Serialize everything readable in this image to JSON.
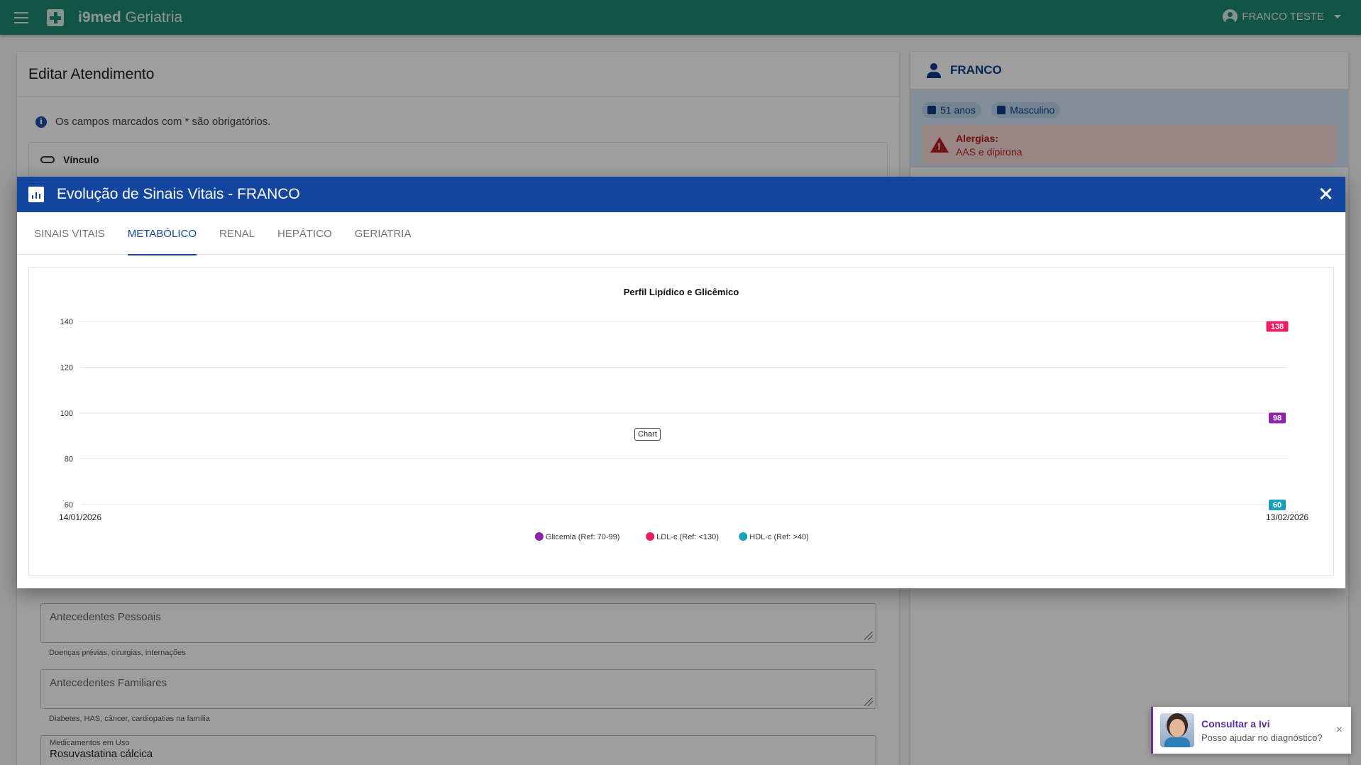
{
  "app": {
    "brand_bold": "i9med",
    "brand_rest": "Geriatria",
    "user_name": "FRANCO TESTE"
  },
  "form": {
    "title": "Editar Atendimento",
    "required_note": "Os campos marcados com * são obrigatórios.",
    "vinculo_label": "Vínculo",
    "antecedentes_pessoais": {
      "placeholder": "Antecedentes Pessoais",
      "helper": "Doenças prévias, cirurgias, internações"
    },
    "antecedentes_familiares": {
      "placeholder": "Antecedentes Familiares",
      "helper": "Diabetes, HAS, câncer, cardiopatias na família"
    },
    "medicamentos": {
      "label": "Medicamentos em Uso",
      "value": "Rosuvastatina cálcica"
    }
  },
  "patient": {
    "name": "FRANCO",
    "age": "51 anos",
    "sex": "Masculino",
    "allergy_title": "Alergias:",
    "allergy_text": "AAS e dipirona"
  },
  "dialog": {
    "title": "Evolução de Sinais Vitais - FRANCO",
    "tabs": [
      "SINAIS VITAIS",
      "METABÓLICO",
      "RENAL",
      "HEPÁTICO",
      "GERIATRIA"
    ],
    "active_tab": 1,
    "chart_tag": "Chart"
  },
  "chart_data": {
    "type": "line",
    "title": "Perfil Lipídico e Glicêmico",
    "x": [
      "14/01/2026",
      "13/02/2026"
    ],
    "ylim": [
      60,
      140
    ],
    "yticks": [
      60,
      80,
      100,
      120,
      140
    ],
    "grid": true,
    "legend_position": "bottom",
    "series": [
      {
        "name": "Glicemia (Ref: 70-99)",
        "color": "#8e24aa",
        "values": [
          null,
          98
        ]
      },
      {
        "name": "LDL-c (Ref: <130)",
        "color": "#e91e63",
        "values": [
          null,
          138
        ]
      },
      {
        "name": "HDL-c (Ref: >40)",
        "color": "#17a2b8",
        "values": [
          null,
          60
        ]
      }
    ]
  },
  "ivi": {
    "title": "Consultar a Ivi",
    "subtitle": "Posso ajudar no diagnóstico?",
    "close": "×"
  },
  "colors": {
    "appbar": "#1f8a70",
    "dialog_header": "#1446a0",
    "accent_purple": "#6a2fa4"
  }
}
